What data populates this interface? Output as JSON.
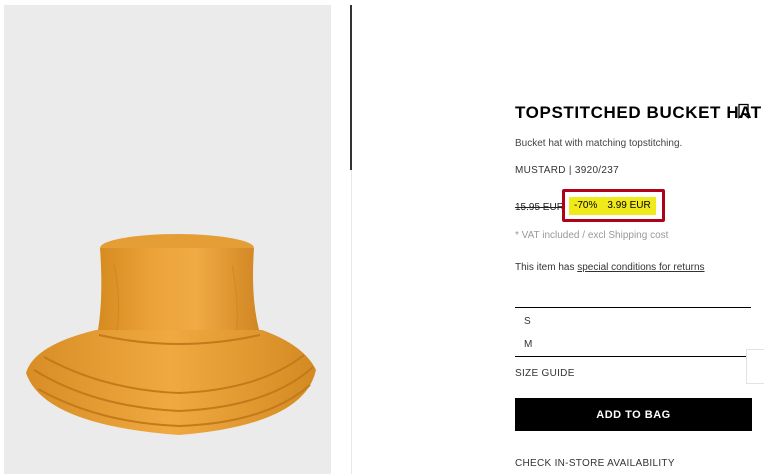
{
  "product": {
    "title": "TOPSTITCHED BUCKET HAT",
    "description": "Bucket hat with matching topstitching.",
    "reference": "MUSTARD | 3920/237",
    "old_price": "15.95 EUR",
    "discount": "-70%",
    "sale_price": "3.99 EUR",
    "vat_note": "* VAT included / excl Shipping cost",
    "conditions_prefix": "This item has ",
    "conditions_link": "special conditions for returns"
  },
  "sizes": [
    "S",
    "M"
  ],
  "actions": {
    "size_guide": "SIZE GUIDE",
    "add_to_bag": "ADD TO BAG",
    "check_store": "CHECK IN-STORE AVAILABILITY"
  },
  "icons": {
    "bookmark": "bookmark-icon"
  },
  "colors": {
    "hat": "#e8a63a",
    "highlight": "#f0ea1a",
    "annotation_border": "#b0001a",
    "button_bg": "#000000"
  }
}
